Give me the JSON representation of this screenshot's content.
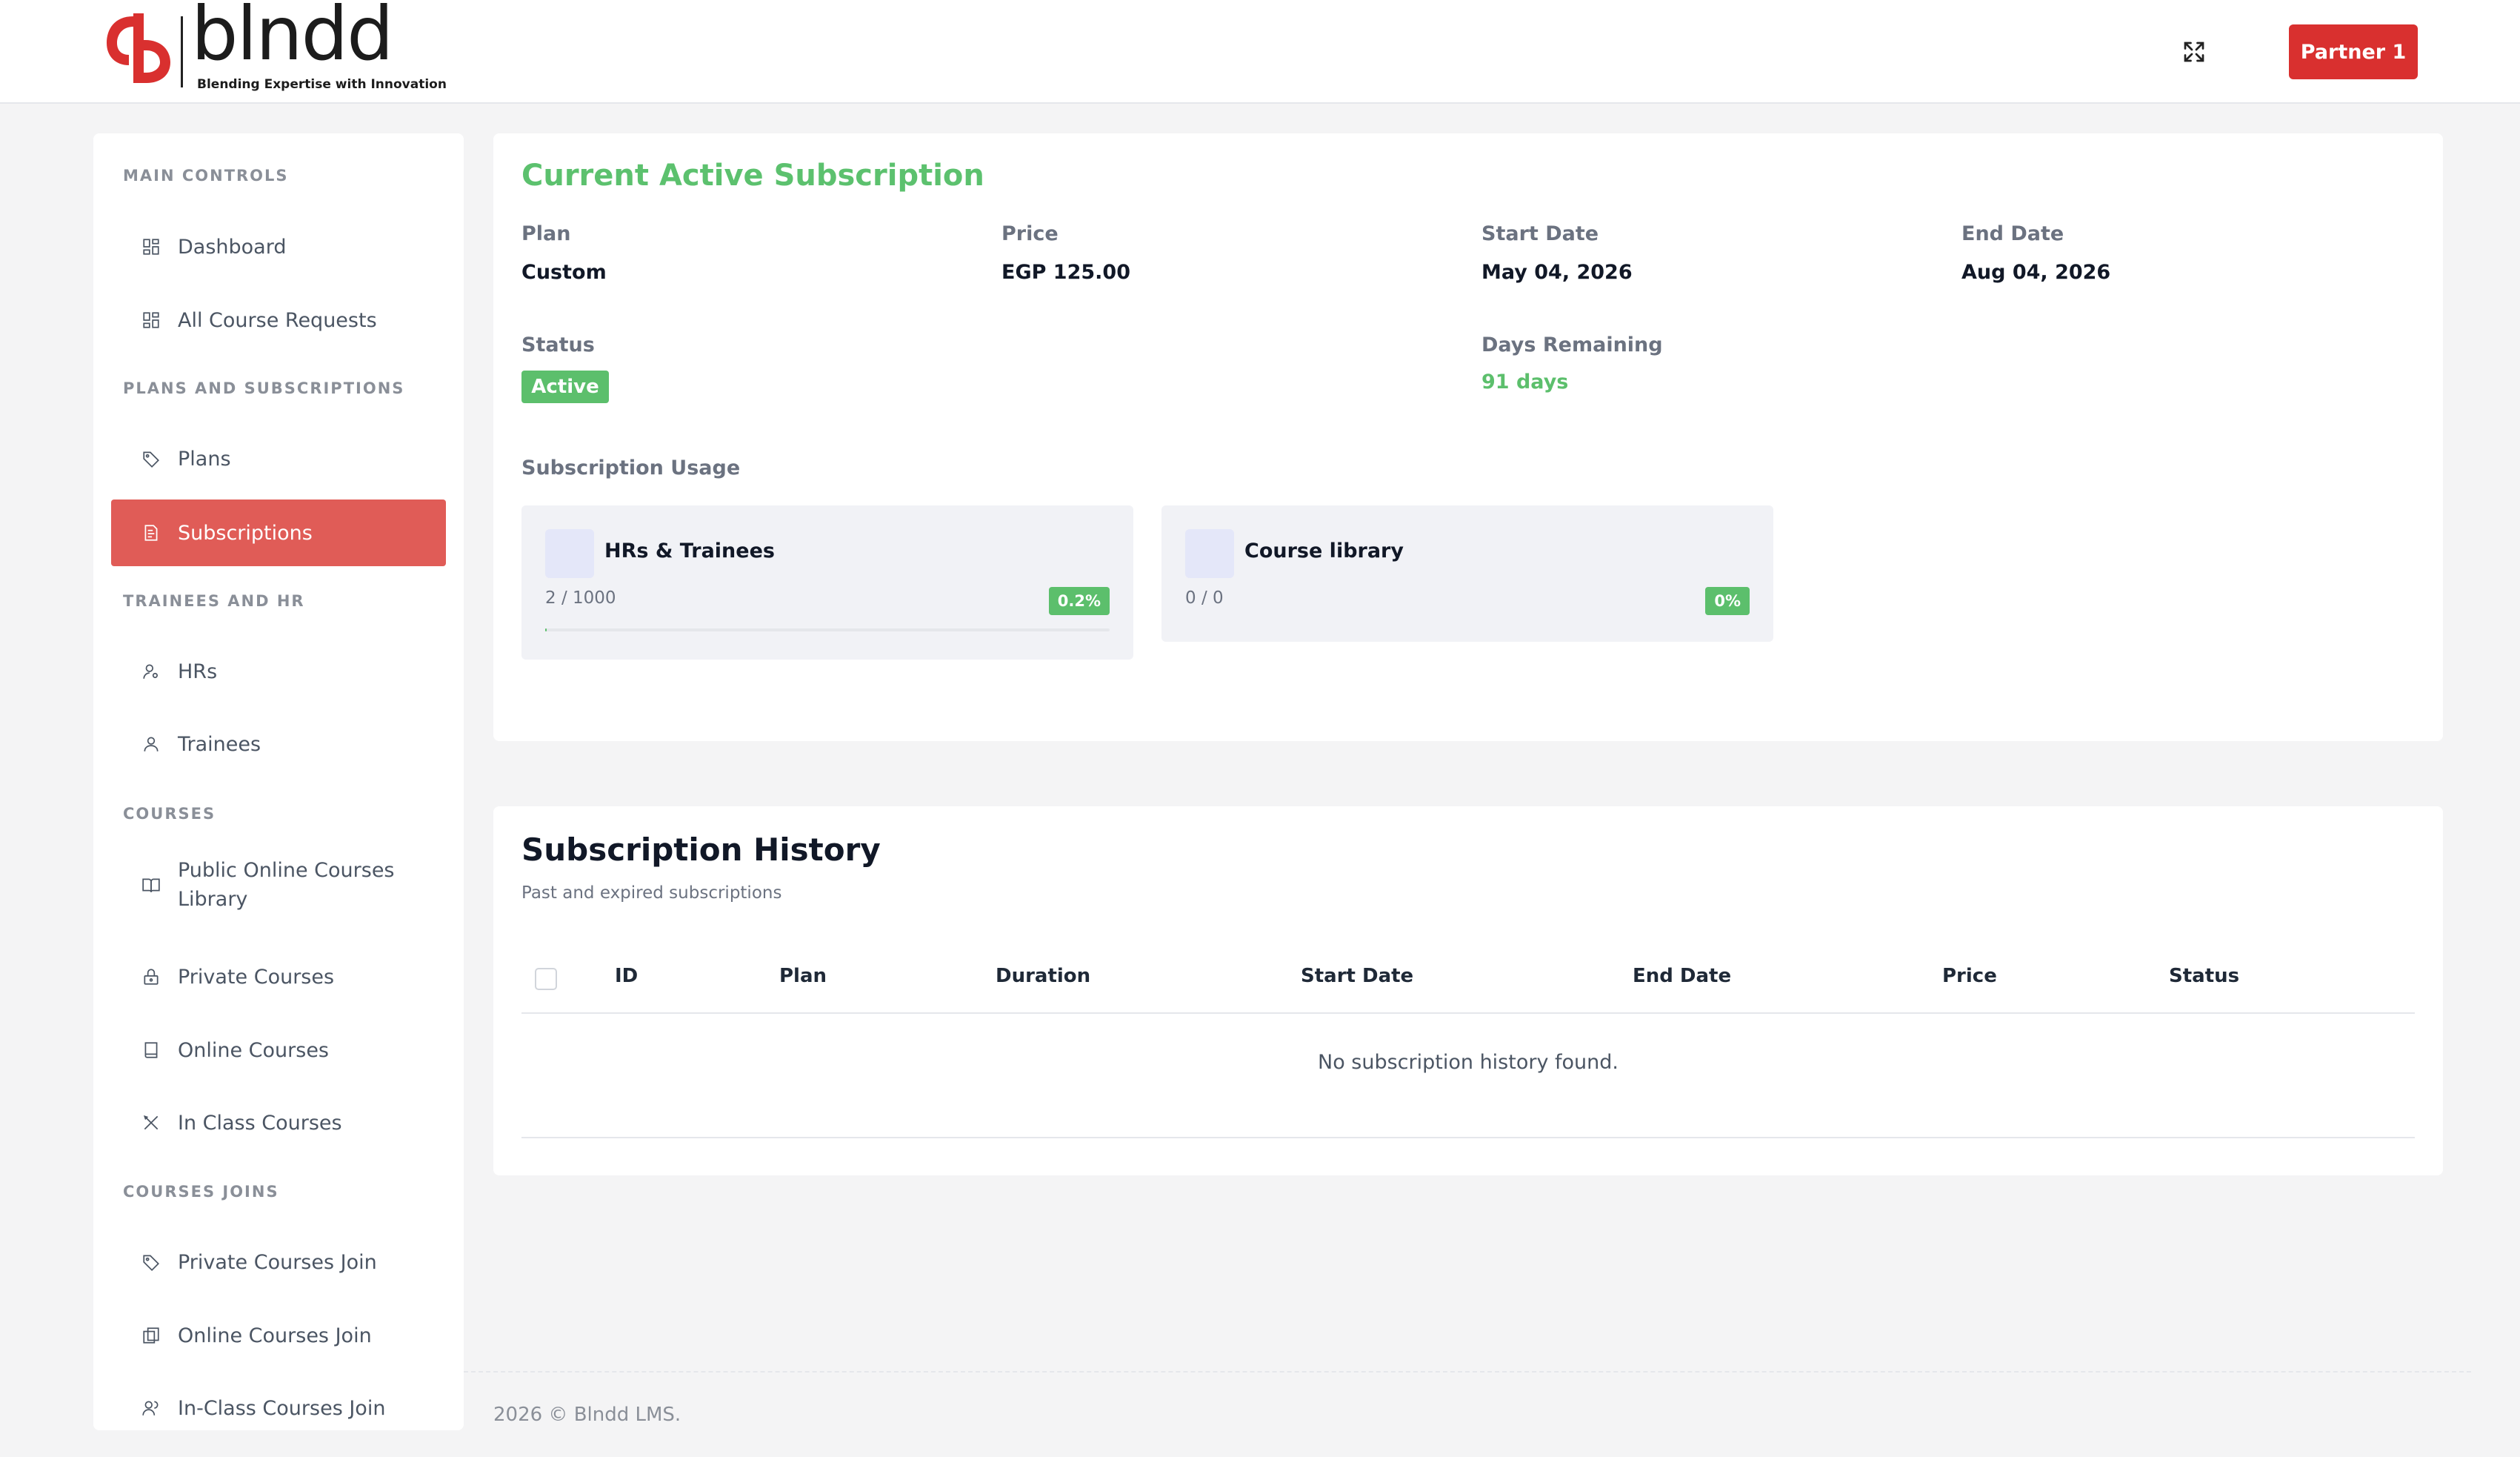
{
  "brand": {
    "name": "blndd",
    "tagline": "Blending Expertise with  Innovation",
    "accent": "#d9302f"
  },
  "header": {
    "expand_icon": "expand-icon",
    "user_button": "Partner 1"
  },
  "sidebar": {
    "sections": [
      {
        "title": "MAIN CONTROLS",
        "items": [
          {
            "label": "Dashboard",
            "icon": "grid-icon"
          },
          {
            "label": "All Course Requests",
            "icon": "grid-icon"
          }
        ]
      },
      {
        "title": "PLANS AND SUBSCRIPTIONS",
        "items": [
          {
            "label": "Plans",
            "icon": "tag-icon"
          },
          {
            "label": "Subscriptions",
            "icon": "receipt-icon",
            "active": true
          }
        ]
      },
      {
        "title": "TRAINEES AND HR",
        "items": [
          {
            "label": "HRs",
            "icon": "user-gear-icon"
          },
          {
            "label": "Trainees",
            "icon": "user-icon"
          }
        ]
      },
      {
        "title": "COURSES",
        "items": [
          {
            "label": "Public Online Courses Library",
            "icon": "book-open-icon"
          },
          {
            "label": "Private Courses",
            "icon": "lock-icon"
          },
          {
            "label": "Online Courses",
            "icon": "book-icon"
          },
          {
            "label": "In Class Courses",
            "icon": "tools-icon"
          }
        ]
      },
      {
        "title": "COURSES JOINS",
        "items": [
          {
            "label": "Private Courses Join",
            "icon": "tag-icon"
          },
          {
            "label": "Online Courses Join",
            "icon": "copy-icon"
          },
          {
            "label": "In-Class Courses Join",
            "icon": "users-icon"
          }
        ]
      }
    ]
  },
  "current": {
    "title": "Current Active Subscription",
    "plan_label": "Plan",
    "plan_value": "Custom",
    "price_label": "Price",
    "price_value": "EGP 125.00",
    "start_label": "Start Date",
    "start_value": "May 04, 2026",
    "end_label": "End Date",
    "end_value": "Aug 04, 2026",
    "status_label": "Status",
    "status_value": "Active",
    "days_label": "Days Remaining",
    "days_value": "91 days",
    "usage_title": "Subscription Usage",
    "usage": [
      {
        "name": "HRs & Trainees",
        "count": "2 / 1000",
        "percent": "0.2%",
        "fraction": 0.002
      },
      {
        "name": "Course library",
        "count": "0 / 0",
        "percent": "0%",
        "fraction": 0
      }
    ]
  },
  "history": {
    "title": "Subscription History",
    "subtitle": "Past and expired subscriptions",
    "columns": [
      "ID",
      "Plan",
      "Duration",
      "Start Date",
      "End Date",
      "Price",
      "Status"
    ],
    "empty_message": "No subscription history found."
  },
  "footer": {
    "text": "2026 © Blndd LMS."
  },
  "colors": {
    "success": "#5cbf6c",
    "active_nav": "#e05c57"
  }
}
